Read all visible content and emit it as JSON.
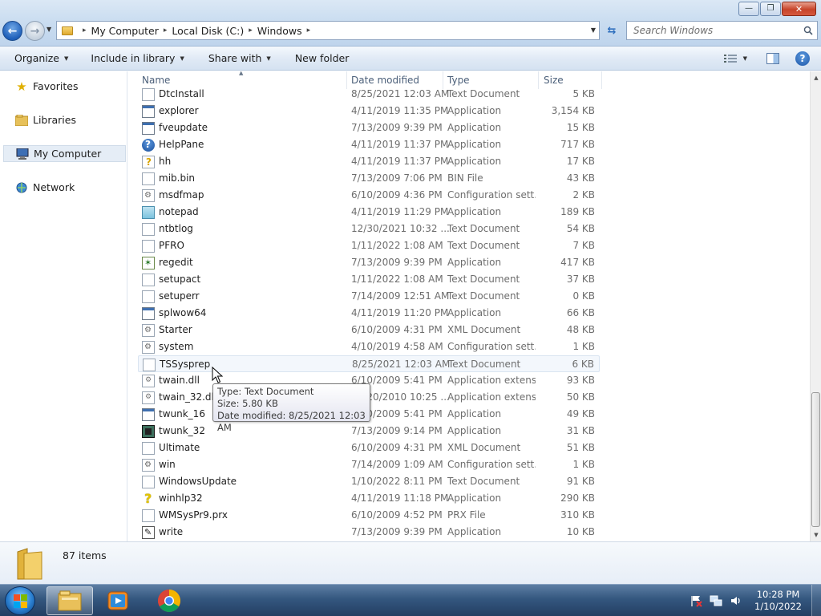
{
  "window": {
    "controls": {
      "minimize": "—",
      "maximize": "❐",
      "close": "✕"
    }
  },
  "address": {
    "crumbs": [
      "My Computer",
      "Local Disk (C:)",
      "Windows"
    ],
    "separator": "▸"
  },
  "search": {
    "placeholder": "Search Windows"
  },
  "commandbar": {
    "organize": "Organize",
    "include_in_library": "Include in library",
    "share_with": "Share with",
    "new_folder": "New folder"
  },
  "navigation": {
    "favorites": "Favorites",
    "libraries": "Libraries",
    "my_computer": "My Computer",
    "network": "Network"
  },
  "columns": {
    "name": "Name",
    "date_modified": "Date modified",
    "type": "Type",
    "size": "Size"
  },
  "files": [
    {
      "name": "DtcInstall",
      "date": "8/25/2021 12:03 AM",
      "type": "Text Document",
      "size": "5 KB",
      "icon": "text-document-icon"
    },
    {
      "name": "explorer",
      "date": "4/11/2019 11:35 PM",
      "type": "Application",
      "size": "3,154 KB",
      "icon": "explorer-folder-icon"
    },
    {
      "name": "fveupdate",
      "date": "7/13/2009 9:39 PM",
      "type": "Application",
      "size": "15 KB",
      "icon": "application-icon"
    },
    {
      "name": "HelpPane",
      "date": "4/11/2019 11:37 PM",
      "type": "Application",
      "size": "717 KB",
      "icon": "help-icon"
    },
    {
      "name": "hh",
      "date": "4/11/2019 11:37 PM",
      "type": "Application",
      "size": "17 KB",
      "icon": "help-file-icon"
    },
    {
      "name": "mib.bin",
      "date": "7/13/2009 7:06 PM",
      "type": "BIN File",
      "size": "43 KB",
      "icon": "text-document-icon"
    },
    {
      "name": "msdfmap",
      "date": "6/10/2009 4:36 PM",
      "type": "Configuration sett...",
      "size": "2 KB",
      "icon": "config-icon"
    },
    {
      "name": "notepad",
      "date": "4/11/2019 11:29 PM",
      "type": "Application",
      "size": "189 KB",
      "icon": "notepad-icon"
    },
    {
      "name": "ntbtlog",
      "date": "12/30/2021 10:32 ...",
      "type": "Text Document",
      "size": "54 KB",
      "icon": "text-document-icon"
    },
    {
      "name": "PFRO",
      "date": "1/11/2022 1:08 AM",
      "type": "Text Document",
      "size": "7 KB",
      "icon": "text-document-icon"
    },
    {
      "name": "regedit",
      "date": "7/13/2009 9:39 PM",
      "type": "Application",
      "size": "417 KB",
      "icon": "regedit-icon"
    },
    {
      "name": "setupact",
      "date": "1/11/2022 1:08 AM",
      "type": "Text Document",
      "size": "37 KB",
      "icon": "text-document-icon"
    },
    {
      "name": "setuperr",
      "date": "7/14/2009 12:51 AM",
      "type": "Text Document",
      "size": "0 KB",
      "icon": "text-document-icon"
    },
    {
      "name": "splwow64",
      "date": "4/11/2019 11:20 PM",
      "type": "Application",
      "size": "66 KB",
      "icon": "application-icon"
    },
    {
      "name": "Starter",
      "date": "6/10/2009 4:31 PM",
      "type": "XML Document",
      "size": "48 KB",
      "icon": "config-icon"
    },
    {
      "name": "system",
      "date": "4/10/2019 4:58 AM",
      "type": "Configuration sett...",
      "size": "1 KB",
      "icon": "config-icon"
    },
    {
      "name": "TSSysprep",
      "date": "8/25/2021 12:03 AM",
      "type": "Text Document",
      "size": "6 KB",
      "icon": "text-document-icon"
    },
    {
      "name": "twain.dll",
      "date": "6/10/2009 5:41 PM",
      "type": "Application extens...",
      "size": "93 KB",
      "icon": "dll-icon"
    },
    {
      "name": "twain_32.dll",
      "date": "11/20/2010 10:25 ...",
      "type": "Application extens...",
      "size": "50 KB",
      "icon": "dll-icon"
    },
    {
      "name": "twunk_16",
      "date": "6/10/2009 5:41 PM",
      "type": "Application",
      "size": "49 KB",
      "icon": "application-icon"
    },
    {
      "name": "twunk_32",
      "date": "7/13/2009 9:14 PM",
      "type": "Application",
      "size": "31 KB",
      "icon": "dark-application-icon"
    },
    {
      "name": "Ultimate",
      "date": "6/10/2009 4:31 PM",
      "type": "XML Document",
      "size": "51 KB",
      "icon": "text-document-icon"
    },
    {
      "name": "win",
      "date": "7/14/2009 1:09 AM",
      "type": "Configuration sett...",
      "size": "1 KB",
      "icon": "config-icon"
    },
    {
      "name": "WindowsUpdate",
      "date": "1/10/2022 8:11 PM",
      "type": "Text Document",
      "size": "91 KB",
      "icon": "text-document-icon"
    },
    {
      "name": "winhlp32",
      "date": "4/11/2019 11:18 PM",
      "type": "Application",
      "size": "290 KB",
      "icon": "question-icon"
    },
    {
      "name": "WMSysPr9.prx",
      "date": "6/10/2009 4:52 PM",
      "type": "PRX File",
      "size": "310 KB",
      "icon": "text-document-icon"
    },
    {
      "name": "write",
      "date": "7/13/2009 9:39 PM",
      "type": "Application",
      "size": "10 KB",
      "icon": "wordpad-icon"
    }
  ],
  "tooltip": {
    "line1": "Type: Text Document",
    "line2": "Size: 5.80 KB",
    "line3": "Date modified: 8/25/2021 12:03 AM"
  },
  "status": {
    "items_count": "87 items"
  },
  "taskbar": {
    "time": "10:28 PM",
    "date": "1/10/2022"
  },
  "colors": {
    "taskbar": "#34577f",
    "selection": "#e5edf6",
    "accent": "#1f5fb9"
  }
}
